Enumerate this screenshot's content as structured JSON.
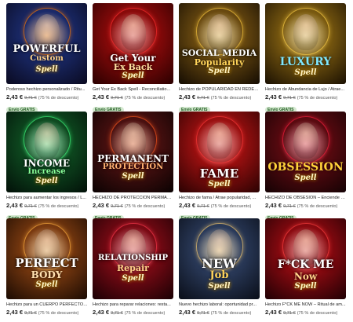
{
  "listings": [
    {
      "title": "Poderoso hechizo personalizado / Ritu...",
      "price": "2,43 €",
      "original_price": "9,71 €",
      "discount": "(75 % de descuento)",
      "badge": "Envío GRATIS",
      "art": {
        "line1": "POWERFUL",
        "line2": "Custom",
        "line3": "Spell",
        "bg": "#1a2a6a",
        "bg2": "#0a0a20",
        "accent": "#ff7a00",
        "line2_color": "#ffd28a"
      }
    },
    {
      "title": "Get Your Ex Back Spell - Reconciliatio...",
      "price": "2,43 €",
      "original_price": "9,71 €",
      "discount": "(75 % de descuento)",
      "badge": "Envío GRATIS",
      "art": {
        "line1": "Get Your",
        "line2": "Ex Back",
        "line3": "Spell",
        "bg": "#8a0a0a",
        "bg2": "#2a0000",
        "accent": "#ff3030",
        "line2_color": "#ffe0a0"
      }
    },
    {
      "title": "Hechizo de POPULARIDAD EN REDES S...",
      "price": "2,43 €",
      "original_price": "9,71 €",
      "discount": "(75 % de descuento)",
      "badge": "Envío GRATIS",
      "art": {
        "line1": "SOCIAL MEDIA",
        "line2": "Popularity",
        "line3": "Spell",
        "bg": "#6a4a10",
        "bg2": "#140c02",
        "accent": "#ffcc40",
        "line2_color": "#ffd35a"
      }
    },
    {
      "title": "Hechizo de Abundancia de Lujo / Atrae...",
      "price": "2,43 €",
      "original_price": "9,71 €",
      "discount": "(75 % de descuento)",
      "badge": "Envío GRATIS",
      "art": {
        "line1": "",
        "line2": "LUXURY",
        "line3": "Spell",
        "bg": "#7a5a10",
        "bg2": "#1a1002",
        "accent": "#ffd24a",
        "line2_color": "#7fe8ff"
      }
    },
    {
      "title": "Hechizo para aumentar los ingresos / L...",
      "price": "2,43 €",
      "original_price": "9,71 €",
      "discount": "(75 % de descuento)",
      "badge": "Envío GRATIS",
      "art": {
        "line1": "INCOME",
        "line2": "Increase",
        "line3": "Spell",
        "bg": "#0e4a20",
        "bg2": "#021008",
        "accent": "#40ff80",
        "line2_color": "#8aff9a"
      }
    },
    {
      "title": "HECHIZO DE PROTECCIÓN PERMANEN...",
      "price": "2,43 €",
      "original_price": "9,71 €",
      "discount": "(75 % de descuento)",
      "badge": "Envío GRATIS",
      "art": {
        "line1": "PERMANENT",
        "line2": "PROTECTION",
        "line3": "Spell",
        "bg": "#4a1010",
        "bg2": "#0a0202",
        "accent": "#ff5a20",
        "line2_color": "#ffb070"
      }
    },
    {
      "title": "Hechizo de fama / Atrae popularidad, ...",
      "price": "2,43 €",
      "original_price": "9,71 €",
      "discount": "(75 % de descuento)",
      "badge": "Envío GRATIS",
      "art": {
        "line1": "FAME",
        "line2": "",
        "line3": "Spell",
        "bg": "#9a1010",
        "bg2": "#2a0202",
        "accent": "#ff3a3a",
        "line2_color": "#ffd28a"
      }
    },
    {
      "title": "HECHIZO DE OBSESIÓN – Enciende el ...",
      "price": "2,43 €",
      "original_price": "9,71 €",
      "discount": "(75 % de descuento)",
      "badge": "Envío GRATIS",
      "art": {
        "line1": "",
        "line2": "OBSESSION",
        "line3": "Spell",
        "bg": "#5a0a10",
        "bg2": "#140204",
        "accent": "#ff2040",
        "line2_color": "#ffd23a"
      }
    },
    {
      "title": "Hechizo para un CUERPO PERFECTO - ...",
      "price": "2,43 €",
      "original_price": "9,71 €",
      "discount": "(75 % de descuento)",
      "badge": "Envío GRATIS",
      "art": {
        "line1": "PERFECT",
        "line2": "BODY",
        "line3": "Spell",
        "bg": "#7a3a10",
        "bg2": "#1a0a02",
        "accent": "#ffb040",
        "line2_color": "#ffe0b0"
      }
    },
    {
      "title": "Hechizo para reparar relaciones: resta...",
      "price": "2,43 €",
      "original_price": "9,71 €",
      "discount": "(75 % de descuento)",
      "badge": "Envío GRATIS",
      "art": {
        "line1": "RELATIONSHIP",
        "line2": "Repair",
        "line3": "Spell",
        "bg": "#7a0a14",
        "bg2": "#1a0004",
        "accent": "#ff3a50",
        "line2_color": "#ffd28a"
      }
    },
    {
      "title": "Nuevo hechizo laboral: oportunidad pr...",
      "price": "2,43 €",
      "original_price": "9,71 €",
      "discount": "(75 % de descuento)",
      "badge": "Envío GRATIS",
      "art": {
        "line1": "NEW",
        "line2": "Job",
        "line3": "Spell",
        "bg": "#2a3a5a",
        "bg2": "#0a0e18",
        "accent": "#ffd070",
        "line2_color": "#ffd35a"
      }
    },
    {
      "title": "Hechizo F*CK ME NOW – Ritual de am...",
      "price": "2,43 €",
      "original_price": "9,71 €",
      "discount": "(75 % de descuento)",
      "badge": "Envío GRATIS",
      "art": {
        "line1": "F*CK ME",
        "line2": "Now",
        "line3": "Spell",
        "bg": "#8a0a10",
        "bg2": "#200004",
        "accent": "#ff4040",
        "line2_color": "#ffd28a"
      }
    }
  ]
}
